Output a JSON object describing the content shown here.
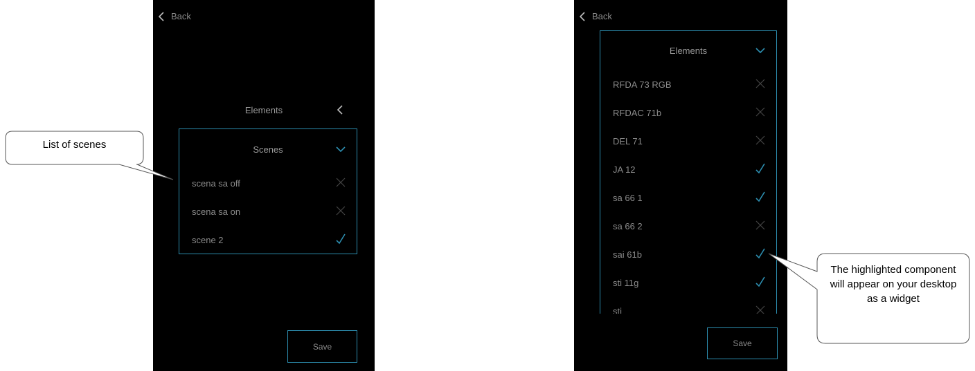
{
  "left_screen": {
    "back_label": "Back",
    "elements_label": "Elements",
    "scenes_header": "Scenes",
    "scenes": [
      {
        "label": "scena sa off",
        "state": "off"
      },
      {
        "label": "scena sa on",
        "state": "off"
      },
      {
        "label": "scene 2",
        "state": "on"
      }
    ],
    "save_label": "Save"
  },
  "right_screen": {
    "back_label": "Back",
    "elements_header": "Elements",
    "items": [
      {
        "label": "RFDA 73 RGB",
        "state": "off"
      },
      {
        "label": "RFDAC 71b",
        "state": "off"
      },
      {
        "label": "DEL 71",
        "state": "off"
      },
      {
        "label": "JA 12",
        "state": "on"
      },
      {
        "label": "sa 66 1",
        "state": "on"
      },
      {
        "label": "sa 66 2",
        "state": "off"
      },
      {
        "label": "sai 61b",
        "state": "on"
      },
      {
        "label": "sti 11g",
        "state": "on"
      },
      {
        "label": "sti",
        "state": "off"
      }
    ],
    "save_label": "Save"
  },
  "callouts": {
    "scenes_note": "List of scenes",
    "widget_note": "The highlighted component will appear on your desktop as a widget"
  },
  "colors": {
    "background": "#000000",
    "accent": "#2d8fb1",
    "text": "#8a8a8a"
  },
  "icons": {
    "checked": "check-icon",
    "unchecked": "cross-icon",
    "back": "chevron-left-icon",
    "expand": "chevron-down-icon"
  }
}
